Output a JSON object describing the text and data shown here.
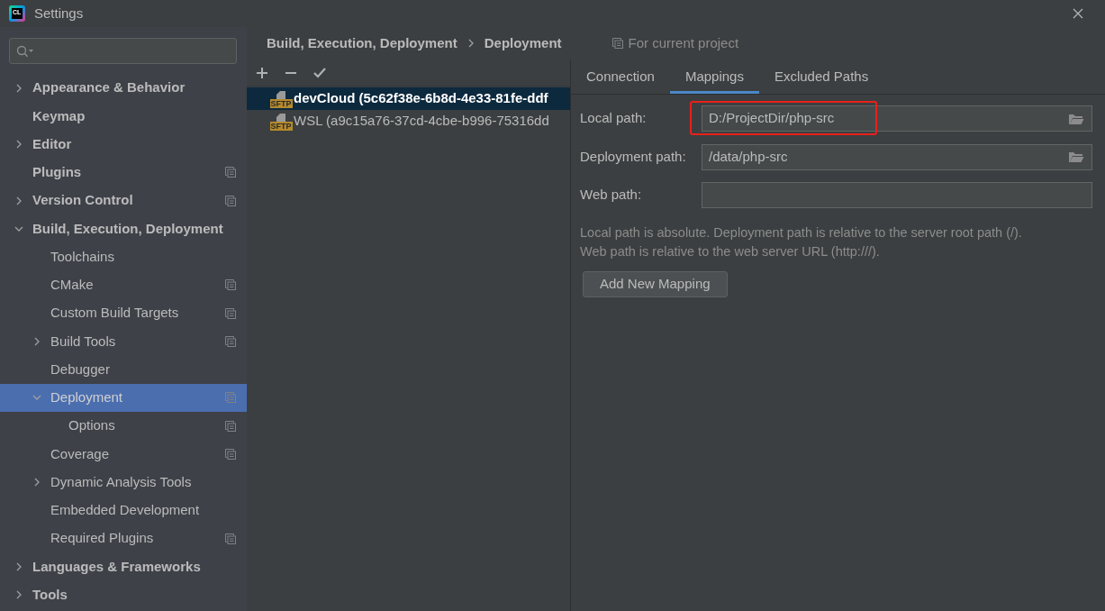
{
  "window": {
    "logo": "CL",
    "title": "Settings"
  },
  "sidebar": {
    "items": [
      {
        "label": "Appearance & Behavior",
        "expanded": false,
        "project_level": false,
        "selected": false
      },
      {
        "label": "Keymap",
        "project_level": false,
        "selected": false
      },
      {
        "label": "Editor",
        "expanded": false,
        "project_level": false,
        "selected": false
      },
      {
        "label": "Plugins",
        "project_level": true,
        "selected": false
      },
      {
        "label": "Version Control",
        "expanded": false,
        "project_level": true,
        "selected": false
      },
      {
        "label": "Build, Execution, Deployment",
        "expanded": true,
        "project_level": false,
        "selected": false,
        "children": [
          {
            "label": "Toolchains",
            "project_level": false,
            "selected": false
          },
          {
            "label": "CMake",
            "project_level": true,
            "selected": false
          },
          {
            "label": "Custom Build Targets",
            "project_level": true,
            "selected": false
          },
          {
            "label": "Build Tools",
            "expanded": false,
            "project_level": true,
            "selected": false
          },
          {
            "label": "Debugger",
            "project_level": false,
            "selected": false
          },
          {
            "label": "Deployment",
            "expanded": true,
            "project_level": true,
            "selected": true,
            "children": [
              {
                "label": "Options",
                "project_level": true,
                "selected": false
              }
            ]
          },
          {
            "label": "Coverage",
            "project_level": true,
            "selected": false
          },
          {
            "label": "Dynamic Analysis Tools",
            "expanded": false,
            "project_level": false,
            "selected": false
          },
          {
            "label": "Embedded Development",
            "project_level": false,
            "selected": false
          },
          {
            "label": "Required Plugins",
            "project_level": true,
            "selected": false
          }
        ]
      },
      {
        "label": "Languages & Frameworks",
        "expanded": false,
        "project_level": false,
        "selected": false
      },
      {
        "label": "Tools",
        "expanded": false,
        "project_level": false,
        "selected": false
      }
    ]
  },
  "breadcrumb": [
    "Build, Execution, Deployment",
    "Deployment"
  ],
  "scope_note": "For current project",
  "servers": [
    {
      "name": "devCloud (5c62f38e-6b8d-4e33-81fe-ddf",
      "type": "SFTP",
      "selected": true
    },
    {
      "name": "WSL (a9c15a76-37cd-4cbe-b996-75316dd",
      "type": "SFTP",
      "selected": false
    }
  ],
  "tabs": [
    {
      "label": "Connection",
      "selected": false
    },
    {
      "label": "Mappings",
      "selected": true
    },
    {
      "label": "Excluded Paths",
      "selected": false
    }
  ],
  "mappings": {
    "fields": [
      {
        "label": "Local path:",
        "value": "D:/ProjectDir/php-src",
        "browse": true,
        "highlighted": true
      },
      {
        "label": "Deployment path:",
        "value": "/data/php-src",
        "browse": true,
        "highlighted": false
      },
      {
        "label": "Web path:",
        "browse": false,
        "highlighted": false
      }
    ],
    "help": [
      "Local path is absolute. Deployment path is relative to the server root path (/).",
      "Web path is relative to the web server URL (http:///)."
    ],
    "button": "Add New Mapping"
  }
}
